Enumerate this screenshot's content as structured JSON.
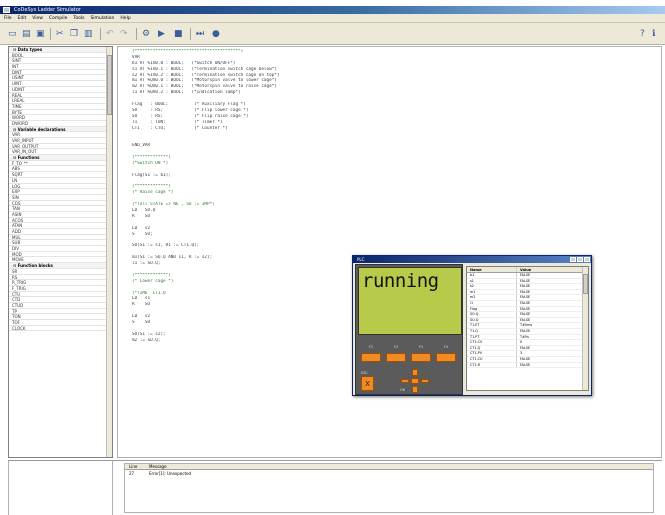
{
  "window": {
    "title": "CoDeSys Ladder Simulator"
  },
  "menu": [
    "File",
    "Edit",
    "View",
    "Compile",
    "Tools",
    "Simulation",
    "Help"
  ],
  "toolbar": [
    "new-icon",
    "open-icon",
    "save-icon",
    "cut-icon",
    "copy-icon",
    "paste-icon",
    "undo-icon",
    "redo-icon",
    "build-icon",
    "run-icon",
    "stop-icon",
    "help-icon"
  ],
  "left_panel": {
    "rows": [
      {
        "kind": "header",
        "label": "Data types"
      },
      {
        "kind": "item",
        "label": "BOOL"
      },
      {
        "kind": "item",
        "label": "SINT"
      },
      {
        "kind": "item",
        "label": "INT"
      },
      {
        "kind": "item",
        "label": "DINT"
      },
      {
        "kind": "item",
        "label": "USINT"
      },
      {
        "kind": "item",
        "label": "UINT"
      },
      {
        "kind": "item",
        "label": "UDINT"
      },
      {
        "kind": "item",
        "label": "REAL"
      },
      {
        "kind": "item",
        "label": "LREAL"
      },
      {
        "kind": "item",
        "label": "TIME"
      },
      {
        "kind": "item",
        "label": "BYTE"
      },
      {
        "kind": "item",
        "label": "WORD"
      },
      {
        "kind": "item",
        "label": "DWORD"
      },
      {
        "kind": "header",
        "label": "Variable declarations"
      },
      {
        "kind": "item",
        "label": "VAR"
      },
      {
        "kind": "item",
        "label": "VAR_INPUT"
      },
      {
        "kind": "item",
        "label": "VAR_OUTPUT"
      },
      {
        "kind": "item",
        "label": "VAR_IN_OUT"
      },
      {
        "kind": "header",
        "label": "Functions"
      },
      {
        "kind": "item",
        "label": "F_TO_**"
      },
      {
        "kind": "item",
        "label": "ABS"
      },
      {
        "kind": "item",
        "label": "SQRT"
      },
      {
        "kind": "item",
        "label": "LN"
      },
      {
        "kind": "item",
        "label": "LOG"
      },
      {
        "kind": "item",
        "label": "EXP"
      },
      {
        "kind": "item",
        "label": "SIN"
      },
      {
        "kind": "item",
        "label": "COS"
      },
      {
        "kind": "item",
        "label": "TAN"
      },
      {
        "kind": "item",
        "label": "ASIN"
      },
      {
        "kind": "item",
        "label": "ACOS"
      },
      {
        "kind": "item",
        "label": "ATAN"
      },
      {
        "kind": "item",
        "label": "ADD"
      },
      {
        "kind": "item",
        "label": "MUL"
      },
      {
        "kind": "item",
        "label": "SUB"
      },
      {
        "kind": "item",
        "label": "DIV"
      },
      {
        "kind": "item",
        "label": "MOD"
      },
      {
        "kind": "item",
        "label": "MOVE"
      },
      {
        "kind": "header",
        "label": "Function blocks"
      },
      {
        "kind": "item",
        "label": "SR"
      },
      {
        "kind": "item",
        "label": "RS"
      },
      {
        "kind": "item",
        "label": "R_TRIG"
      },
      {
        "kind": "item",
        "label": "F_TRIG"
      },
      {
        "kind": "item",
        "label": "CTU"
      },
      {
        "kind": "item",
        "label": "CTD"
      },
      {
        "kind": "item",
        "label": "CTUD"
      },
      {
        "kind": "item",
        "label": "TP"
      },
      {
        "kind": "item",
        "label": "TON"
      },
      {
        "kind": "item",
        "label": "TOF"
      },
      {
        "kind": "item",
        "label": "CLOCK"
      }
    ]
  },
  "code_lines": [
    {
      "t": "(*****************************************)",
      "c": true
    },
    {
      "t": "VAR",
      "c": false
    },
    {
      "t": "b1 AT %IX0.0 : BOOL;   (*Switch ON/OFF*)",
      "c": false
    },
    {
      "t": "s1 AT %IX0.1 : BOOL;   (*Termination switch cage below*)",
      "c": false
    },
    {
      "t": "s2 AT %IX0.2 : BOOL;   (*Termination switch cage on top*)",
      "c": false
    },
    {
      "t": "m1 AT %QX0.0 : BOOL;   (*Motorspin valve to lower cage*)",
      "c": false
    },
    {
      "t": "m2 AT %QX0.1 : BOOL;   (*Motorspin valve to raise cage*)",
      "c": false
    },
    {
      "t": "l1 AT %QX0.2 : BOOL;   (*Indication lamp*)",
      "c": false
    },
    {
      "t": "",
      "c": false
    },
    {
      "t": "Flag   : BOOL;          (* Auxiliary Flag *)",
      "c": false
    },
    {
      "t": "SO     : RS;            (* Flip lower cage *)",
      "c": false
    },
    {
      "t": "SU     : RS;            (* Flip raise cage *)",
      "c": false
    },
    {
      "t": "T1     : TON;           (* Timer *)",
      "c": false
    },
    {
      "t": "CT1    : CTU;           (* Counter *)",
      "c": false
    },
    {
      "t": "",
      "c": false
    },
    {
      "t": "",
      "c": false
    },
    {
      "t": "END_VAR",
      "c": false
    },
    {
      "t": "",
      "c": false
    },
    {
      "t": "(*************)",
      "c": true
    },
    {
      "t": "(*Switch ON *)",
      "c": true
    },
    {
      "t": "",
      "c": false
    },
    {
      "t": "Flag(S1 := b1);",
      "c": false
    },
    {
      "t": "",
      "c": false
    },
    {
      "t": "(*************)",
      "c": true
    },
    {
      "t": "(* Raise cage *)",
      "c": true
    },
    {
      "t": "",
      "c": false
    },
    {
      "t": "(*Toll STATE => NE , SU := IMP*)",
      "c": true
    },
    {
      "t": "LD   SO.Q",
      "c": false
    },
    {
      "t": "R    SO",
      "c": false
    },
    {
      "t": "",
      "c": false
    },
    {
      "t": "LD   s2",
      "c": false
    },
    {
      "t": "S    SU;",
      "c": false
    },
    {
      "t": "",
      "c": false
    },
    {
      "t": "SU(S1 := s1, R1 := CT1.Q);",
      "c": false
    },
    {
      "t": "",
      "c": false
    },
    {
      "t": "m1(S1 := SO.Q AND s1, R := s2);",
      "c": false
    },
    {
      "t": "l1 := SU.Q;",
      "c": false
    },
    {
      "t": "",
      "c": false
    },
    {
      "t": "(*************)",
      "c": true
    },
    {
      "t": "(* Lower cage *)",
      "c": true
    },
    {
      "t": "",
      "c": false
    },
    {
      "t": "(*TIME  CT1.Q",
      "c": true
    },
    {
      "t": "LD   s1",
      "c": false
    },
    {
      "t": "R    SU",
      "c": false
    },
    {
      "t": "",
      "c": false
    },
    {
      "t": "LD   s2",
      "c": false
    },
    {
      "t": "S    SO",
      "c": false
    },
    {
      "t": "",
      "c": false
    },
    {
      "t": "SO(S1 := s2);",
      "c": false
    },
    {
      "t": "m2 := SO.Q;",
      "c": false
    }
  ],
  "simulator": {
    "title": "PLC",
    "display_text": "running",
    "fkey_labels": [
      "F1",
      "F2",
      "F3",
      "F4"
    ],
    "esc_label": "ESC",
    "esc_glyph": "X",
    "nav_label": "OK",
    "table": {
      "headers": [
        "Name",
        "Value"
      ],
      "rows": [
        [
          "b1",
          "FALSE"
        ],
        [
          "s1",
          "FALSE"
        ],
        [
          "s2",
          "FALSE"
        ],
        [
          "m1",
          "FALSE"
        ],
        [
          "m2",
          "FALSE"
        ],
        [
          "l1",
          "FALSE"
        ],
        [
          "Flag",
          "FALSE"
        ],
        [
          "SO.Q",
          "FALSE"
        ],
        [
          "SU.Q",
          "FALSE"
        ],
        [
          "T1.ET",
          "T#0ms"
        ],
        [
          "T1.Q",
          "FALSE"
        ],
        [
          "T1.PT",
          "T#5s"
        ],
        [
          "CT1.CV",
          "0"
        ],
        [
          "CT1.Q",
          "FALSE"
        ],
        [
          "CT1.PV",
          "3"
        ],
        [
          "CT1.CU",
          "FALSE"
        ],
        [
          "CT1.R",
          "FALSE"
        ]
      ]
    }
  },
  "messages": {
    "headers": [
      "Line",
      "Message"
    ],
    "rows": [
      [
        "27",
        "Error[1]: Unexpected"
      ]
    ]
  }
}
